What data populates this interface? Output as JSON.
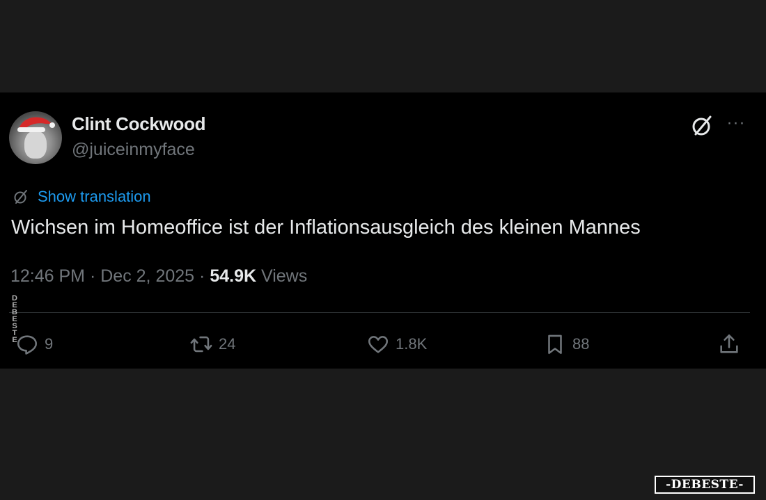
{
  "tweet": {
    "author": {
      "display_name": "Clint Cockwood",
      "handle": "@juiceinmyface",
      "avatar_icon": "avatar-santa-hat"
    },
    "header_icons": [
      "grok-icon",
      "more-icon"
    ],
    "more_glyph": "···",
    "translation_link": "Show translation",
    "text": "Wichsen im Homeoffice ist der Inflationsausgleich des kleinen Mannes",
    "meta": {
      "time": "12:46 PM",
      "separator": "·",
      "date": "Dec 2, 2025",
      "views_count": "54.9K",
      "views_label": "Views"
    },
    "actions": {
      "replies": "9",
      "reposts": "24",
      "likes": "1.8K",
      "bookmarks": "88"
    }
  },
  "watermark": {
    "side_text": "DEBESTE",
    "logo_text": "-DEBESTE-"
  },
  "colors": {
    "background": "#1b1b1b",
    "card": "#000000",
    "primary_text": "#e7e9ea",
    "secondary_text": "#71767b",
    "link": "#1d9bf0"
  }
}
